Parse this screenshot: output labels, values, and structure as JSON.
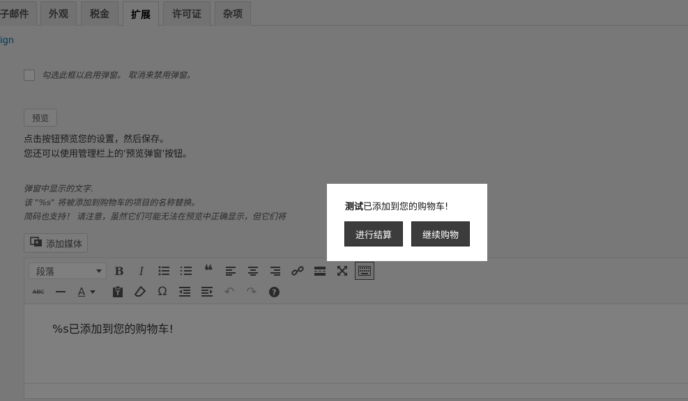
{
  "tabs": [
    {
      "label": "子邮件"
    },
    {
      "label": "外观"
    },
    {
      "label": "税金"
    },
    {
      "label": "扩展"
    },
    {
      "label": "许可证"
    },
    {
      "label": "杂项"
    }
  ],
  "active_tab": "扩展",
  "partial_link": "ign",
  "popup_setting": {
    "checkbox_desc": "勾选此框以启用弹窗。 取消来禁用弹窗。",
    "checked": false
  },
  "preview": {
    "button_label": "预览",
    "desc_line1": "点击按钮预览您的设置，然后保存。",
    "desc_line2": "您还可以使用管理栏上的'预览弹窗'按钮。"
  },
  "popup_text_help": {
    "line1": "弹窗中显示的文字.",
    "line2": "该 \"%s\" 将被添加到购物车的项目的名称替换。",
    "line3": "简码也支持！ 请注意，虽然它们可能无法在预览中正确显示，但它们将"
  },
  "editor": {
    "add_media_label": "添加媒体",
    "format_select_value": "段落",
    "content": "%s已添加到您的购物车!"
  },
  "popup": {
    "item_name": "测试",
    "message": "已添加到您的购物车!",
    "checkout_label": "进行结算",
    "continue_label": "继续购物"
  },
  "colors": {
    "overlay": "#000000",
    "popup_button": "#3c3c3c",
    "link": "#0073aa"
  }
}
